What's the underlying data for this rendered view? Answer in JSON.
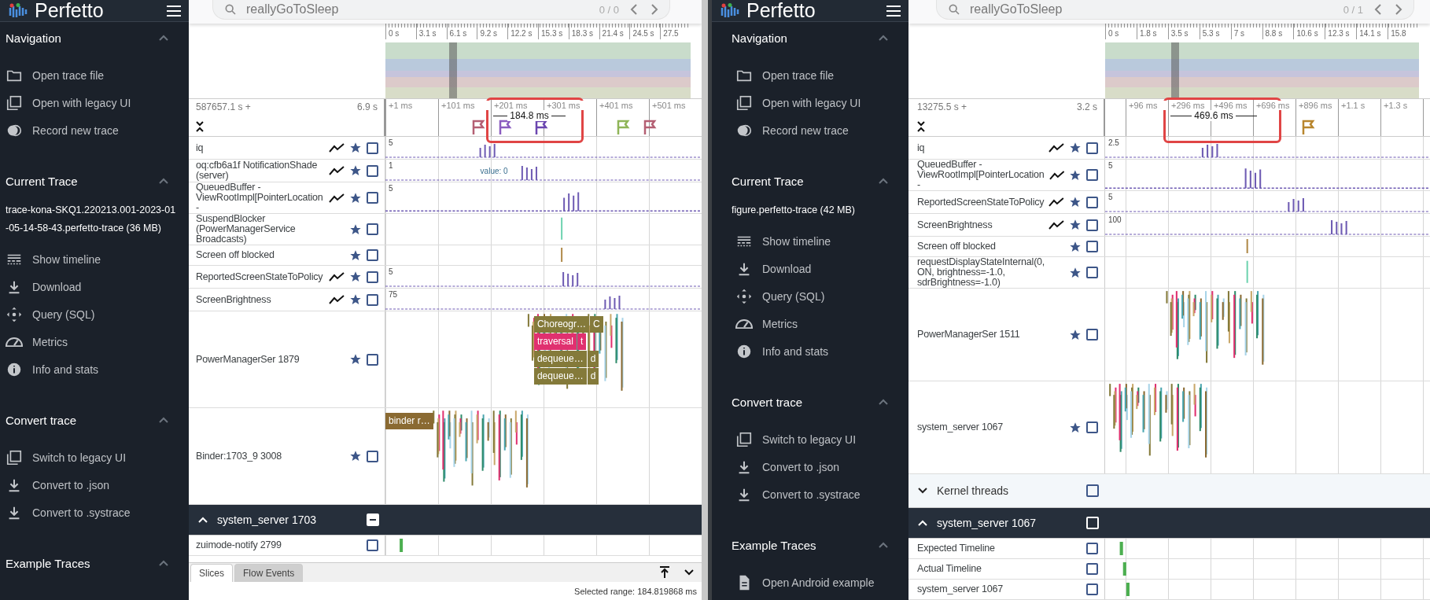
{
  "panes": [
    {
      "logo": "Perfetto",
      "sidebar": [
        {
          "title": "Navigation",
          "expanded": true,
          "items": [
            {
              "label": "Open trace file"
            },
            {
              "label": "Open with legacy UI"
            },
            {
              "label": "Record new trace"
            }
          ]
        },
        {
          "title": "Current Trace",
          "expanded": true,
          "trace_name": "trace-kona-SKQ1.220213.001-2023-01-05-14-58-43.perfetto-trace (36 MB)",
          "items": [
            {
              "label": "Show timeline"
            },
            {
              "label": "Download"
            },
            {
              "label": "Query (SQL)"
            },
            {
              "label": "Metrics"
            },
            {
              "label": "Info and stats"
            }
          ]
        },
        {
          "title": "Convert trace",
          "expanded": true,
          "items": [
            {
              "label": "Switch to legacy UI"
            },
            {
              "label": "Convert to .json"
            },
            {
              "label": "Convert to .systrace"
            }
          ]
        },
        {
          "title": "Example Traces",
          "expanded": true
        }
      ],
      "search": {
        "value": "reallyGoToSleep",
        "count": "0 / 0"
      },
      "overview_ticks": [
        "0 s",
        "3.1 s",
        "6.1 s",
        "9.2 s",
        "12.2 s",
        "15.3 s",
        "18.3 s",
        "21.4 s",
        "24.5 s",
        "27.5"
      ],
      "time_offset": "587657.1 s +",
      "time_span": "6.9 s",
      "ticks": [
        "+1 ms",
        "+101 ms",
        "+201 ms",
        "+301 ms",
        "+401 ms",
        "+501 ms"
      ],
      "flags": [
        {
          "color": "#b45f73"
        },
        {
          "color": "#8b5cc0"
        },
        {
          "color": "#6b46b0"
        },
        {
          "color": "#8fb558"
        },
        {
          "color": "#b45f73"
        }
      ],
      "measurement": "184.8 ms",
      "tracks": [
        {
          "kind": "counter",
          "name": "iq",
          "scale": "5",
          "checked": false
        },
        {
          "kind": "counter",
          "name": "oq:cfb6a1f NotificationShade (server)",
          "scale": "1",
          "value": "value: 0",
          "checked": false
        },
        {
          "kind": "counter",
          "name": "QueuedBuffer - ViewRootImpl[PointerLocation -",
          "scale": "5",
          "checked": false
        },
        {
          "kind": "slice",
          "name": "SuspendBlocker (PowerManagerService Broadcasts)",
          "checked": false
        },
        {
          "kind": "slice",
          "name": "Screen off blocked",
          "checked": false
        },
        {
          "kind": "counter",
          "name": "ReportedScreenStateToPolicy",
          "scale": "5",
          "checked": false
        },
        {
          "kind": "counter",
          "name": "ScreenBrightness",
          "scale": "75",
          "checked": false
        },
        {
          "kind": "thread",
          "name": "PowerManagerSer 1879",
          "checked": false,
          "slice_rows": [
            {
              "color": "#847a3a",
              "cells": [
                "Choreogr…",
                "C"
              ]
            },
            {
              "color": "#e0306f",
              "cells": [
                "traversal",
                "t"
              ]
            },
            {
              "color": "#847a3a",
              "cells": [
                "dequeue…",
                "d"
              ]
            },
            {
              "color": "#847a3a",
              "cells": [
                "dequeue…",
                "d"
              ]
            }
          ]
        },
        {
          "kind": "thread",
          "name": "Binder:1703_9 3008",
          "checked": false,
          "slice_rows": [
            {
              "color": "#8a6a32",
              "cells": [
                "binder r…"
              ]
            }
          ]
        }
      ],
      "groups": [
        {
          "name": "system_server 1703",
          "expanded": true,
          "indeterminate": true,
          "tracks": [
            {
              "kind": "plain",
              "name": "zuimode-notify 2799",
              "checked": false
            }
          ]
        }
      ],
      "bottom_panel": {
        "tabs": [
          {
            "label": "Slices",
            "selected": true
          },
          {
            "label": "Flow Events",
            "selected": false
          }
        ],
        "status": "Selected range: 184.819868 ms"
      }
    },
    {
      "logo": "Perfetto",
      "sidebar": [
        {
          "title": "Navigation",
          "expanded": true,
          "items": [
            {
              "label": "Open trace file"
            },
            {
              "label": "Open with legacy UI"
            },
            {
              "label": "Record new trace"
            }
          ]
        },
        {
          "title": "Current Trace",
          "expanded": true,
          "trace_name": "figure.perfetto-trace (42 MB)",
          "items": [
            {
              "label": "Show timeline"
            },
            {
              "label": "Download"
            },
            {
              "label": "Query (SQL)"
            },
            {
              "label": "Metrics"
            },
            {
              "label": "Info and stats"
            }
          ]
        },
        {
          "title": "Convert trace",
          "expanded": true,
          "items": [
            {
              "label": "Switch to legacy UI"
            },
            {
              "label": "Convert to .json"
            },
            {
              "label": "Convert to .systrace"
            }
          ]
        },
        {
          "title": "Example Traces",
          "expanded": true,
          "items": [
            {
              "label": "Open Android example"
            }
          ]
        }
      ],
      "search": {
        "value": "reallyGoToSleep",
        "count": "0 / 1"
      },
      "overview_ticks": [
        "0 s",
        "1.8 s",
        "3.5 s",
        "5.3 s",
        "7 s",
        "8.8 s",
        "10.6 s",
        "12.3 s",
        "14.1 s",
        "15.8"
      ],
      "time_offset": "13275.5 s +",
      "time_span": "3.2 s",
      "ticks": [
        "+96 ms",
        "+296 ms",
        "+496 ms",
        "+696 ms",
        "+896 ms",
        "+1.1 s",
        "+1.3 s"
      ],
      "flags": [
        {
          "color": "#b8862e"
        }
      ],
      "measurement": "469.6 ms",
      "tracks": [
        {
          "kind": "counter",
          "name": "iq",
          "scale": "2.5",
          "checked": false
        },
        {
          "kind": "counter",
          "name": "QueuedBuffer - ViewRootImpl[PointerLocation -",
          "scale": "5",
          "checked": false
        },
        {
          "kind": "counter",
          "name": "ReportedScreenStateToPolicy",
          "scale": "5",
          "checked": false
        },
        {
          "kind": "counter",
          "name": "ScreenBrightness",
          "scale": "100",
          "checked": false
        },
        {
          "kind": "slice",
          "name": "Screen off blocked",
          "checked": false
        },
        {
          "kind": "slice",
          "name": "requestDisplayStateInternal(0, ON, brightness=-1.0, sdrBrightness=-1.0)",
          "checked": false
        },
        {
          "kind": "thread",
          "name": "PowerManagerSer 1511",
          "checked": false
        },
        {
          "kind": "thread",
          "name": "system_server 1067",
          "checked": false
        }
      ],
      "groups": [
        {
          "name": "Kernel threads",
          "expanded": false,
          "indeterminate": false
        },
        {
          "name": "system_server 1067",
          "expanded": true,
          "indeterminate": false,
          "tracks": [
            {
              "kind": "plain",
              "name": "Expected Timeline",
              "checked": false
            },
            {
              "kind": "plain",
              "name": "Actual Timeline",
              "checked": false
            },
            {
              "kind": "plain",
              "name": "system_server 1067",
              "checked": false
            }
          ]
        }
      ]
    }
  ]
}
